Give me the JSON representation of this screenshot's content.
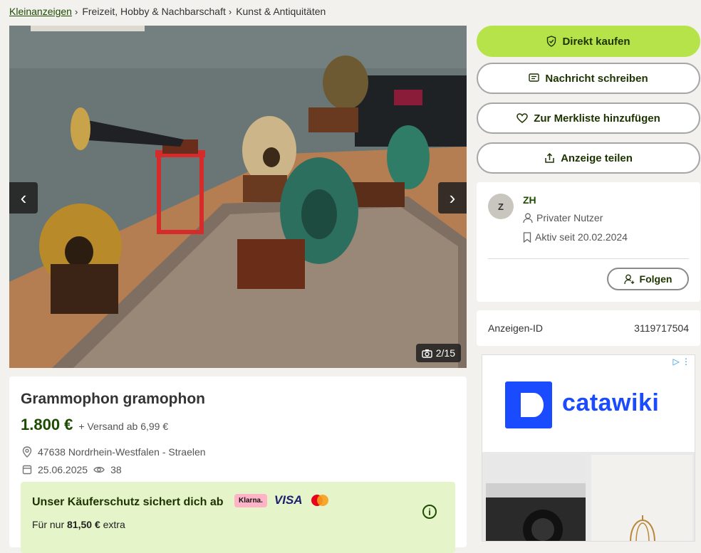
{
  "breadcrumb": {
    "items": [
      "Kleinanzeigen",
      "Freizeit, Hobby & Nachbarschaft",
      "Kunst & Antiquitäten"
    ]
  },
  "gallery": {
    "counter": "2/15",
    "prev_icon": "chevron-left-icon",
    "next_icon": "chevron-right-icon"
  },
  "listing": {
    "title": "Grammophon gramophon",
    "price": "1.800 €",
    "shipping": "+ Versand ab 6,99 €",
    "location": "47638 Nordrhein-Westfalen - Straelen",
    "date": "25.06.2025",
    "views": "38"
  },
  "protection": {
    "title": "Unser Käuferschutz sichert dich ab",
    "sub_prefix": "Für nur",
    "sub_amount": "81,50 €",
    "sub_suffix": "extra",
    "klarna": "Klarna.",
    "visa": "VISA"
  },
  "actions": {
    "buy": "Direkt kaufen",
    "message": "Nachricht schreiben",
    "watchlist": "Zur Merkliste hinzufügen",
    "share": "Anzeige teilen"
  },
  "seller": {
    "initial": "Z",
    "name": "ZH",
    "type": "Privater Nutzer",
    "active_since": "Aktiv seit 20.02.2024",
    "follow": "Folgen"
  },
  "ad_id": {
    "label": "Anzeigen-ID",
    "value": "3119717504"
  },
  "advertisement": {
    "brand": "catawiki"
  },
  "colors": {
    "accent_green": "#b6e34a",
    "dark_green": "#1d4b00",
    "protection_bg": "#e5f5c9",
    "ad_blue": "#1a4bff"
  }
}
